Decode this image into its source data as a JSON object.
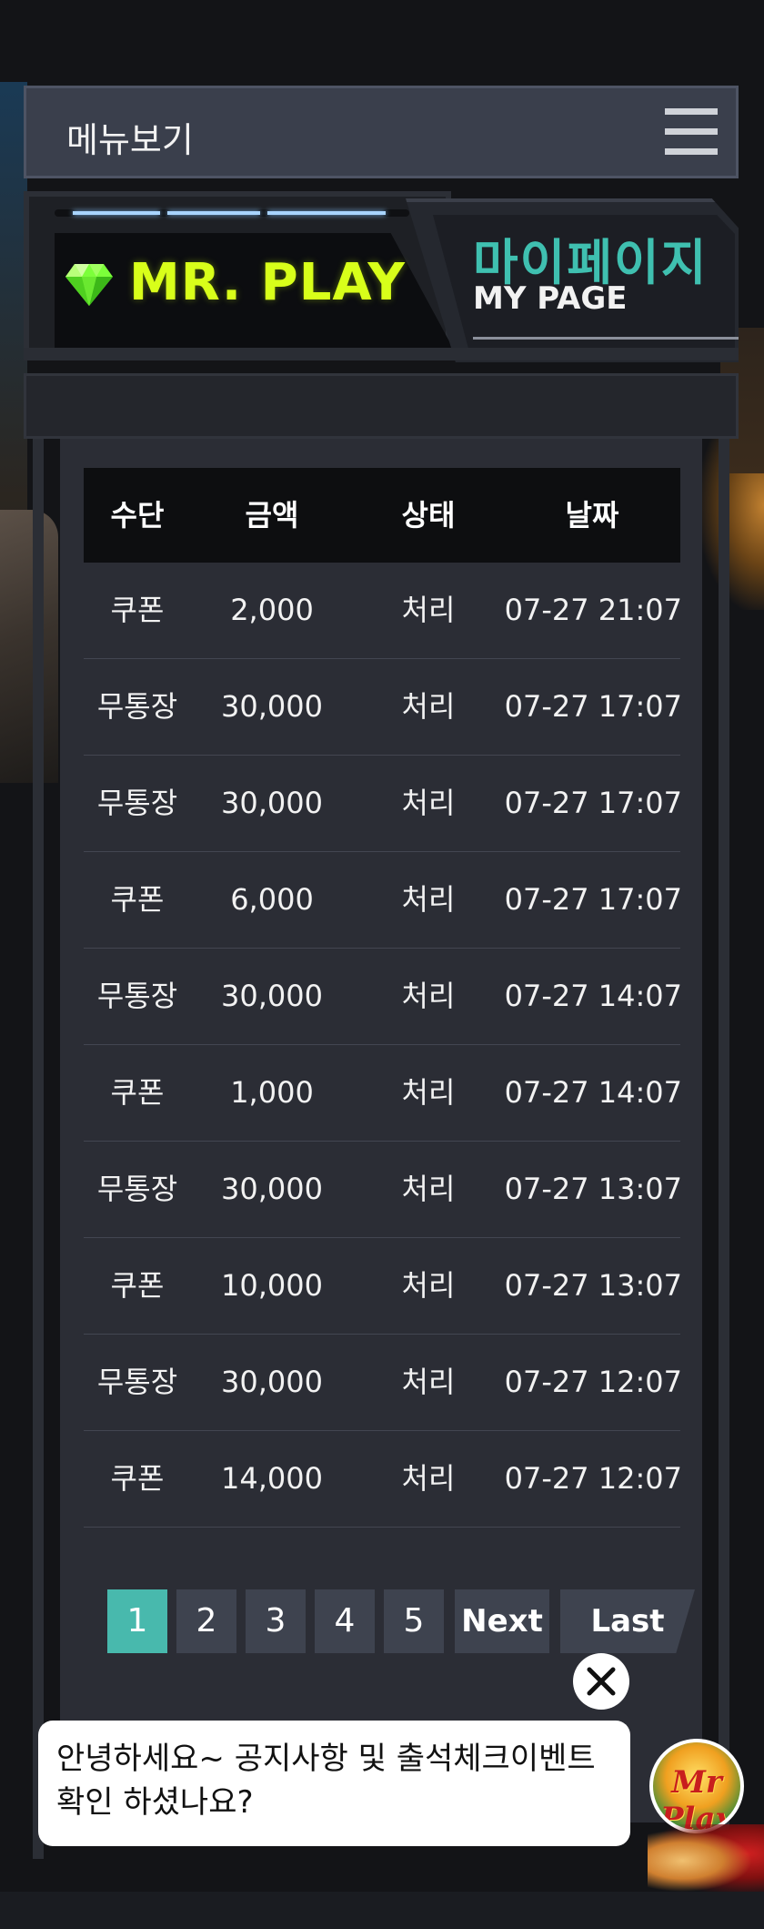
{
  "menu": {
    "label": "메뉴보기"
  },
  "banner": {
    "logo_text": "MR. PLAY",
    "title_kr": "마이페이지",
    "title_en": "MY PAGE"
  },
  "colors": {
    "accent_lime": "#d8ff1a",
    "accent_teal": "#3fc0b0",
    "active_page": "#48b9ad"
  },
  "table": {
    "headers": [
      "수단",
      "금액",
      "상태",
      "날짜"
    ],
    "rows": [
      [
        "쿠폰",
        "2,000",
        "처리",
        "07-27 21:07"
      ],
      [
        "무통장",
        "30,000",
        "처리",
        "07-27 17:07"
      ],
      [
        "무통장",
        "30,000",
        "처리",
        "07-27 17:07"
      ],
      [
        "쿠폰",
        "6,000",
        "처리",
        "07-27 17:07"
      ],
      [
        "무통장",
        "30,000",
        "처리",
        "07-27 14:07"
      ],
      [
        "쿠폰",
        "1,000",
        "처리",
        "07-27 14:07"
      ],
      [
        "무통장",
        "30,000",
        "처리",
        "07-27 13:07"
      ],
      [
        "쿠폰",
        "10,000",
        "처리",
        "07-27 13:07"
      ],
      [
        "무통장",
        "30,000",
        "처리",
        "07-27 12:07"
      ],
      [
        "쿠폰",
        "14,000",
        "처리",
        "07-27 12:07"
      ]
    ]
  },
  "pagination": {
    "pages": [
      "1",
      "2",
      "3",
      "4",
      "5"
    ],
    "current": "1",
    "next_label": "Next",
    "last_label": "Last"
  },
  "chat": {
    "line1": "안녕하세요~ 공지사항 및 출석체크이벤트",
    "line2": "확인 하셨나요?",
    "avatar_text": "Mr Play",
    "close_icon": "close-icon"
  }
}
